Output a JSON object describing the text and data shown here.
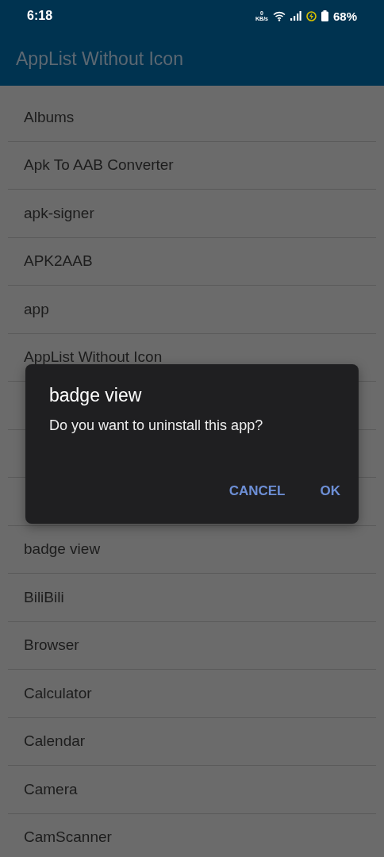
{
  "status_bar": {
    "time": "6:18",
    "net_speed": {
      "value": "0",
      "unit": "KB/s"
    },
    "battery": "68%"
  },
  "app_bar": {
    "title": "AppList Without Icon"
  },
  "app_list": [
    {
      "kind": "app",
      "label": "Albums"
    },
    {
      "kind": "app",
      "label": "Apk To AAB Converter"
    },
    {
      "kind": "app",
      "label": "apk-signer"
    },
    {
      "kind": "app",
      "label": "APK2AAB"
    },
    {
      "kind": "app",
      "label": "app"
    },
    {
      "kind": "app",
      "label": "AppList Without Icon"
    },
    {
      "kind": "covered"
    },
    {
      "kind": "covered"
    },
    {
      "kind": "covered"
    },
    {
      "kind": "app",
      "label": "badge view"
    },
    {
      "kind": "app",
      "label": "BiliBili"
    },
    {
      "kind": "app",
      "label": "Browser"
    },
    {
      "kind": "app",
      "label": "Calculator"
    },
    {
      "kind": "app",
      "label": "Calendar"
    },
    {
      "kind": "app",
      "label": "Camera"
    },
    {
      "kind": "app",
      "label": "CamScanner"
    }
  ],
  "dialog": {
    "title": "badge view",
    "message": "Do you want to uninstall this app?",
    "buttons": [
      "CANCEL",
      "OK"
    ]
  }
}
